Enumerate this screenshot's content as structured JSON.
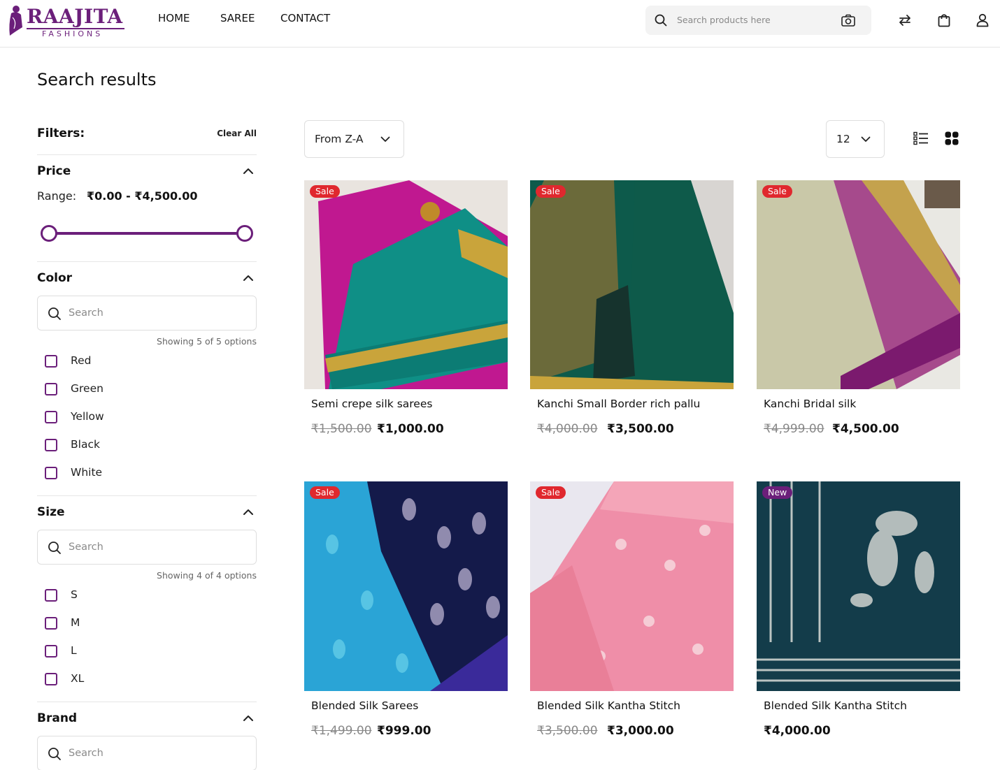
{
  "header": {
    "logo_main": "RAAJITA",
    "logo_sub": "FASHIONS",
    "nav": [
      "HOME",
      "SAREE",
      "CONTACT"
    ],
    "search_placeholder": "Search products here",
    "icons": [
      "search-icon",
      "camera-icon",
      "compare-icon",
      "bag-icon",
      "user-icon"
    ]
  },
  "page": {
    "title": "Search results"
  },
  "filters": {
    "label": "Filters:",
    "clear_all": "Clear All",
    "price": {
      "title": "Price",
      "range_label": "Range:",
      "range_value": "₹0.00 - ₹4,500.00"
    },
    "color": {
      "title": "Color",
      "search_placeholder": "Search",
      "showing": "Showing 5 of 5 options",
      "options": [
        "Red",
        "Green",
        "Yellow",
        "Black",
        "White"
      ]
    },
    "size": {
      "title": "Size",
      "search_placeholder": "Search",
      "showing": "Showing 4 of 4 options",
      "options": [
        "S",
        "M",
        "L",
        "XL"
      ]
    },
    "brand": {
      "title": "Brand",
      "search_placeholder": "Search"
    }
  },
  "toolbar": {
    "sort": "From Z-A",
    "per_page": "12",
    "view_icons": [
      "list-view-icon",
      "grid-view-icon"
    ]
  },
  "products": [
    {
      "badge": "Sale",
      "name": "Semi crepe silk sarees",
      "old_price": "₹1,500.00",
      "price": "₹1,000.00"
    },
    {
      "badge": "Sale",
      "name": "Kanchi Small Border rich pallu",
      "old_price": "₹4,000.00",
      "price": "₹3,500.00"
    },
    {
      "badge": "Sale",
      "name": "Kanchi Bridal silk",
      "old_price": "₹4,999.00",
      "price": "₹4,500.00"
    },
    {
      "badge": "Sale",
      "name": "Blended Silk Sarees",
      "old_price": "₹1,499.00",
      "price": "₹999.00"
    },
    {
      "badge": "Sale",
      "name": "Blended Silk Kantha Stitch",
      "old_price": "₹3,500.00",
      "price": "₹3,000.00"
    },
    {
      "badge": "New",
      "name": "Blended Silk Kantha Stitch",
      "old_price": "",
      "price": "₹4,000.00"
    }
  ],
  "colors": {
    "brand": "#6b1f7a",
    "sale_badge": "#e0282e",
    "new_badge": "#6b1f7a"
  }
}
